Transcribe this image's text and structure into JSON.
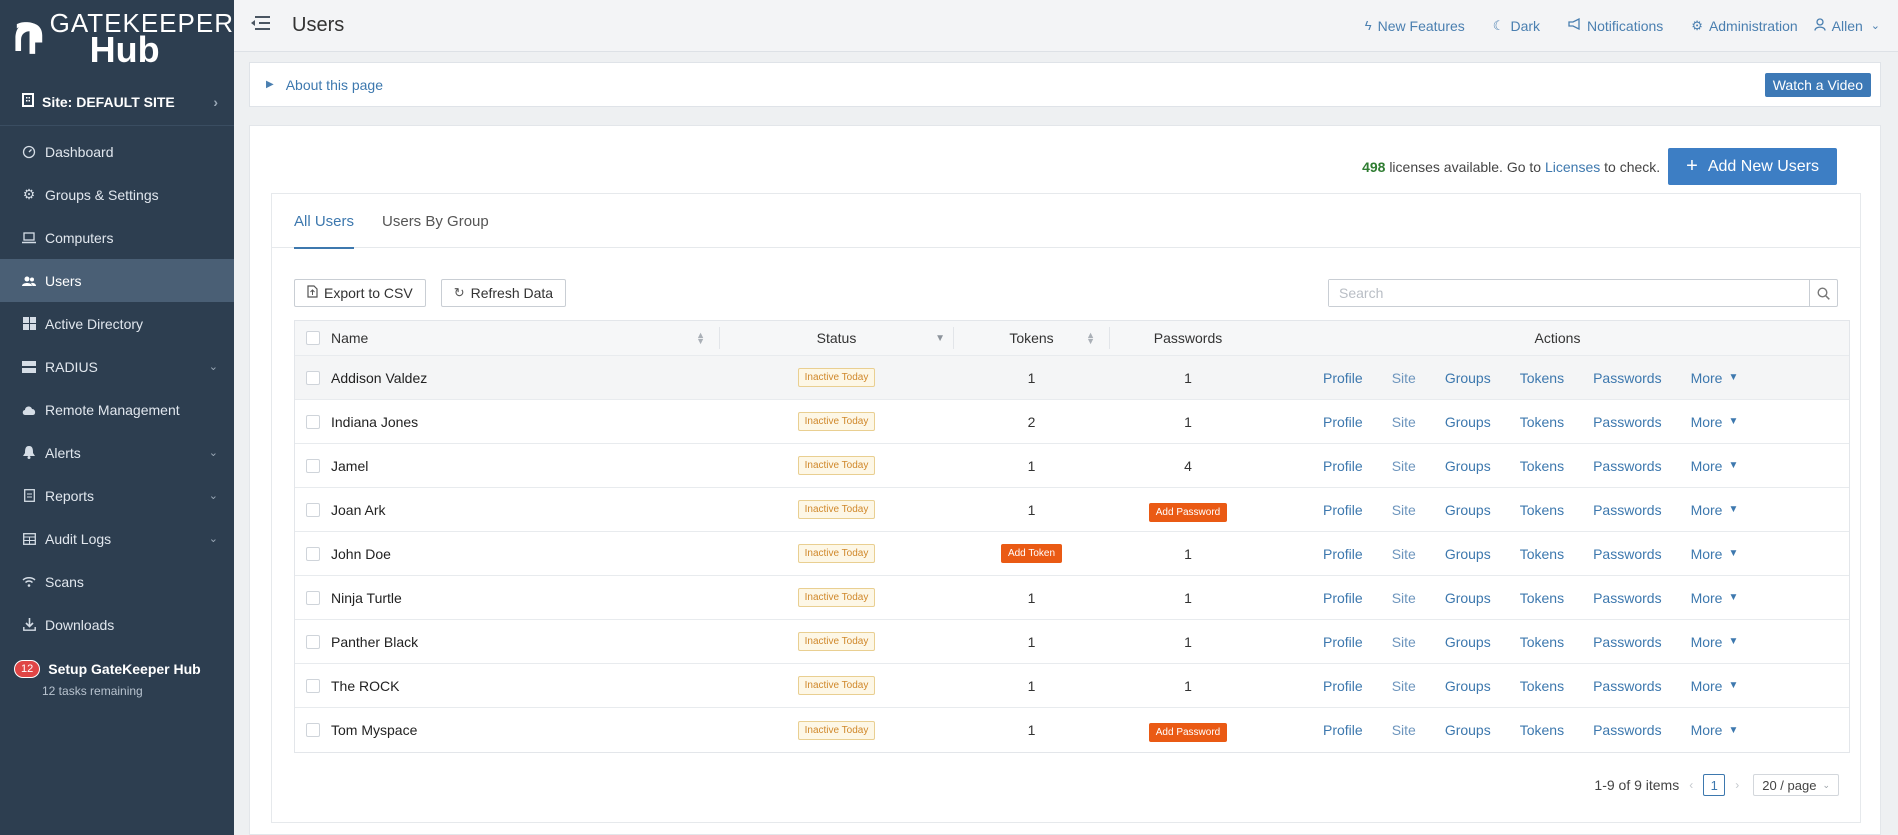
{
  "brand": {
    "line1": "GATEKEEPER",
    "line2": "Hub"
  },
  "sidebar": {
    "site_label": "Site: DEFAULT SITE",
    "items": [
      {
        "label": "Dashboard",
        "icon": "dashboard-icon"
      },
      {
        "label": "Groups & Settings",
        "icon": "gears-icon"
      },
      {
        "label": "Computers",
        "icon": "laptop-icon"
      },
      {
        "label": "Users",
        "icon": "users-icon",
        "active": true
      },
      {
        "label": "Active Directory",
        "icon": "windows-icon"
      },
      {
        "label": "RADIUS",
        "icon": "server-icon",
        "expandable": true
      },
      {
        "label": "Remote Management",
        "icon": "cloud-icon"
      },
      {
        "label": "Alerts",
        "icon": "bell-icon",
        "expandable": true
      },
      {
        "label": "Reports",
        "icon": "report-icon",
        "expandable": true
      },
      {
        "label": "Audit Logs",
        "icon": "table-icon",
        "expandable": true
      },
      {
        "label": "Scans",
        "icon": "wifi-icon"
      },
      {
        "label": "Downloads",
        "icon": "download-icon"
      }
    ],
    "setup": {
      "badge": "12",
      "title": "Setup GateKeeper Hub",
      "subtitle": "12 tasks remaining"
    }
  },
  "topbar": {
    "title": "Users",
    "links": [
      {
        "label": "New Features",
        "icon": "bolt-icon"
      },
      {
        "label": "Dark",
        "icon": "moon-icon"
      },
      {
        "label": "Notifications",
        "icon": "megaphone-icon"
      },
      {
        "label": "Administration",
        "icon": "gear-icon"
      },
      {
        "label": "Allen",
        "icon": "user-icon"
      }
    ]
  },
  "about": {
    "label": "About this page",
    "watch": "Watch a Video"
  },
  "licenses": {
    "count": "498",
    "text1": "licenses available. Go to",
    "link": "Licenses",
    "text2": "to check."
  },
  "add_button": "Add New Users",
  "tabs": [
    "All Users",
    "Users By Group"
  ],
  "toolbar": {
    "export": "Export to CSV",
    "refresh": "Refresh Data",
    "search_placeholder": "Search"
  },
  "table": {
    "headers": {
      "name": "Name",
      "status": "Status",
      "tokens": "Tokens",
      "passwords": "Passwords",
      "actions": "Actions"
    },
    "actions": [
      "Profile",
      "Site",
      "Groups",
      "Tokens",
      "Passwords",
      "More"
    ],
    "rows": [
      {
        "name": "Addison Valdez",
        "status": "Inactive Today",
        "tokens": "1",
        "passwords": "1"
      },
      {
        "name": "Indiana Jones",
        "status": "Inactive Today",
        "tokens": "2",
        "passwords": "1"
      },
      {
        "name": "Jamel",
        "status": "Inactive Today",
        "tokens": "1",
        "passwords": "4"
      },
      {
        "name": "Joan Ark",
        "status": "Inactive Today",
        "tokens": "1",
        "passwords": "Add Password"
      },
      {
        "name": "John Doe",
        "status": "Inactive Today",
        "tokens": "Add Token",
        "passwords": "1"
      },
      {
        "name": "Ninja Turtle",
        "status": "Inactive Today",
        "tokens": "1",
        "passwords": "1"
      },
      {
        "name": "Panther Black",
        "status": "Inactive Today",
        "tokens": "1",
        "passwords": "1"
      },
      {
        "name": "The ROCK",
        "status": "Inactive Today",
        "tokens": "1",
        "passwords": "1"
      },
      {
        "name": "Tom Myspace",
        "status": "Inactive Today",
        "tokens": "1",
        "passwords": "Add Password"
      }
    ]
  },
  "pagination": {
    "summary": "1-9 of 9 items",
    "page": "1",
    "page_size": "20 / page"
  }
}
